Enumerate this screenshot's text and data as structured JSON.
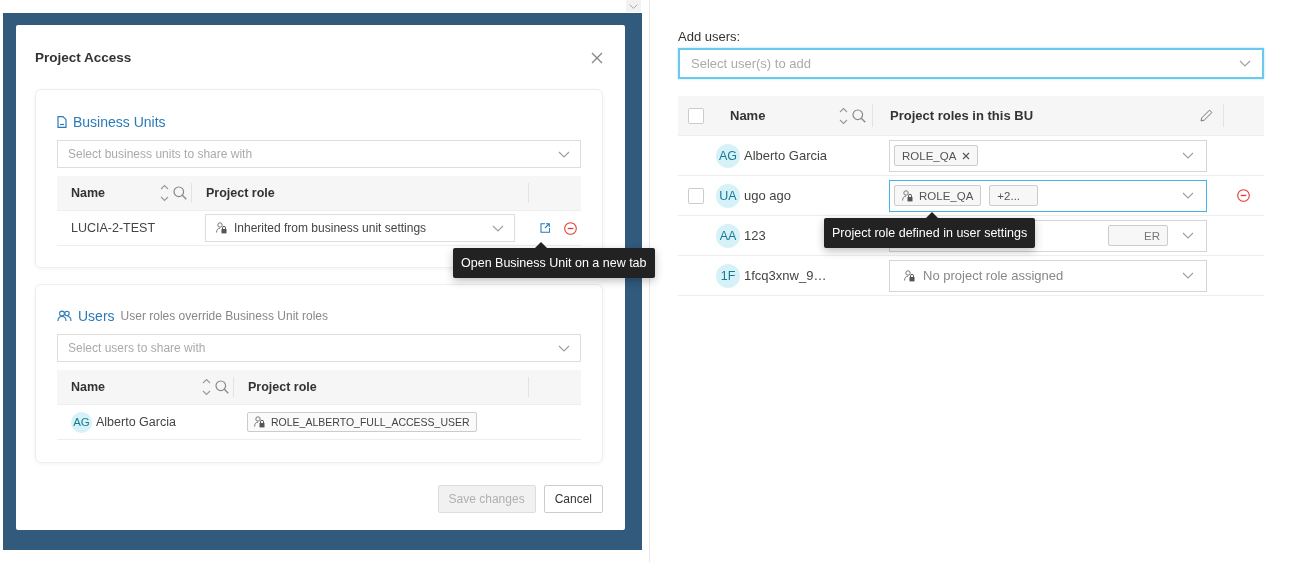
{
  "modal": {
    "title": "Project Access",
    "business_units": {
      "title": "Business Units",
      "placeholder": "Select business units to share with",
      "columns": [
        "Name",
        "Project role"
      ],
      "rows": [
        {
          "name": "LUCIA-2-TEST",
          "role": "Inherited from business unit settings"
        }
      ],
      "tooltip": "Open Business Unit on a new tab"
    },
    "users": {
      "title": "Users",
      "subtitle": "User roles override Business Unit roles",
      "placeholder": "Select users to share with",
      "columns": [
        "Name",
        "Project role"
      ],
      "rows": [
        {
          "initials": "AG",
          "name": "Alberto Garcia",
          "role": "ROLE_ALBERTO_FULL_ACCESS_USER"
        }
      ]
    },
    "buttons": [
      {
        "label": "Save changes",
        "disabled": true
      },
      {
        "label": "Cancel",
        "disabled": false
      }
    ]
  },
  "add_users": {
    "label": "Add users:",
    "placeholder": "Select user(s) to add",
    "focused": true,
    "select_all": {
      "checked": false
    },
    "columns": [
      "Name",
      "Project roles in this BU"
    ],
    "rows": [
      {
        "initials": "AG",
        "name": "Alberto Garcia",
        "hovered": false,
        "roles": [
          {
            "kind": "removable",
            "label": "ROLE_QA"
          }
        ]
      },
      {
        "initials": "UA",
        "name": "ugo ago",
        "hovered": true,
        "checkbox": {
          "checked": false
        },
        "roles": [
          {
            "kind": "locked",
            "label": "ROLE_QA"
          },
          {
            "kind": "more",
            "label": "+2..."
          }
        ]
      },
      {
        "initials": "AA",
        "name": "123",
        "hovered": false,
        "roles": [
          {
            "kind": "clipped",
            "label": "ER"
          }
        ]
      },
      {
        "initials": "1F",
        "name": "1fcq3xnw_9…",
        "hovered": false,
        "roles": [],
        "placeholder": "No project role assigned"
      }
    ],
    "tooltip": "Project role defined in user settings"
  }
}
